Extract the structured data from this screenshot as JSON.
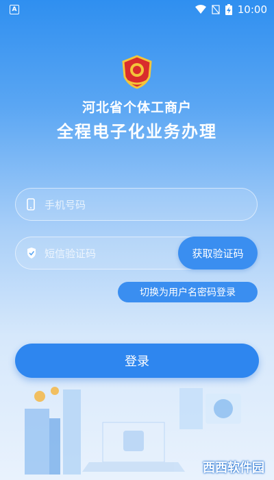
{
  "status_bar": {
    "time": "10:00",
    "indicator": "A"
  },
  "header": {
    "emblem": "emblem-icon",
    "title_line1": "河北省个体工商户",
    "title_line2": "全程电子化业务办理"
  },
  "form": {
    "phone_placeholder": "手机号码",
    "code_placeholder": "短信验证码",
    "get_code_label": "获取验证码",
    "switch_label": "切换为用户名密码登录",
    "login_label": "登录"
  },
  "watermark": "西西软件园"
}
